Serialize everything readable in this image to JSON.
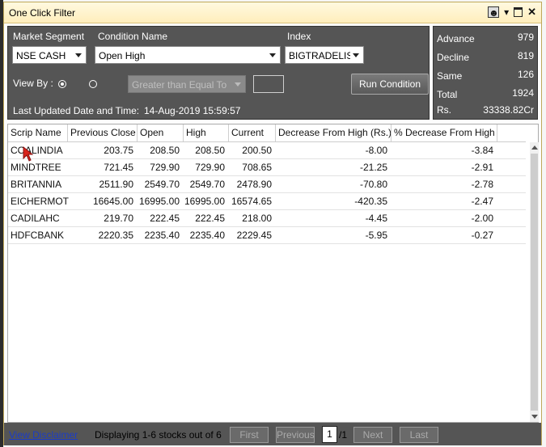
{
  "window": {
    "title": "One Click Filter"
  },
  "filters": {
    "market_segment_label": "Market Segment",
    "market_segment_value": "NSE CASH",
    "condition_label": "Condition Name",
    "condition_value": "Open High",
    "index_label": "Index",
    "index_value": "BIGTRADELIS",
    "view_by_label": "View By :",
    "operator_value": "Greater than Equal To",
    "run_button": "Run Condition",
    "updated_label": "Last Updated Date and Time:",
    "updated_value": "14-Aug-2019 15:59:57"
  },
  "stats": [
    {
      "label": "Advance",
      "value": "979"
    },
    {
      "label": "Decline",
      "value": "819"
    },
    {
      "label": "Same",
      "value": "126"
    },
    {
      "label": "Total",
      "value": "1924"
    },
    {
      "label": "Rs.",
      "value": "33338.82Cr"
    }
  ],
  "table": {
    "columns": [
      "Scrip Name",
      "Previous Close",
      "Open",
      "High",
      "Current",
      "Decrease From High (Rs.)",
      "% Decrease From High"
    ],
    "rows": [
      [
        "COALINDIA",
        "203.75",
        "208.50",
        "208.50",
        "200.50",
        "-8.00",
        "-3.84"
      ],
      [
        "MINDTREE",
        "721.45",
        "729.90",
        "729.90",
        "708.65",
        "-21.25",
        "-2.91"
      ],
      [
        "BRITANNIA",
        "2511.90",
        "2549.70",
        "2549.70",
        "2478.90",
        "-70.80",
        "-2.78"
      ],
      [
        "EICHERMOT",
        "16645.00",
        "16995.00",
        "16995.00",
        "16574.65",
        "-420.35",
        "-2.47"
      ],
      [
        "CADILAHC",
        "219.70",
        "222.45",
        "222.45",
        "218.00",
        "-4.45",
        "-2.00"
      ],
      [
        "HDFCBANK",
        "2220.35",
        "2235.40",
        "2235.40",
        "2229.45",
        "-5.95",
        "-0.27"
      ]
    ]
  },
  "footer": {
    "disclaimer": "View Disclaimer",
    "display_text": "Displaying 1-6 stocks out of 6",
    "first": "First",
    "previous": "Previous",
    "page": "1",
    "page_of": "/1",
    "next": "Next",
    "last": "Last"
  },
  "colors": {
    "panel": "#555555",
    "accent_link": "#1a3cc8",
    "titlebar": "#ffeebc"
  },
  "icons": [
    "user-icon",
    "dropdown-icon",
    "maximize-icon",
    "close-icon",
    "cursor-icon"
  ]
}
